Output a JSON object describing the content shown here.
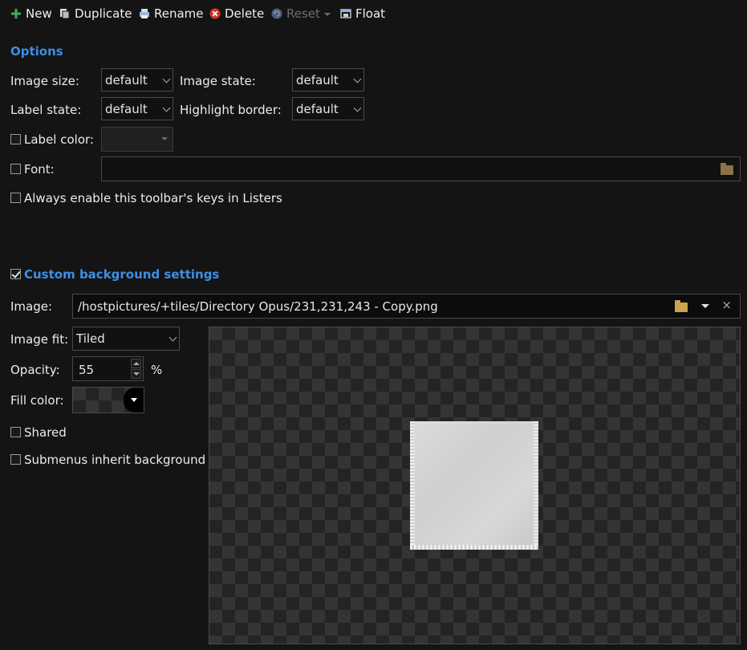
{
  "toolbar": {
    "new_label": "New",
    "duplicate_label": "Duplicate",
    "rename_label": "Rename",
    "delete_label": "Delete",
    "reset_label": "Reset",
    "float_label": "Float"
  },
  "options": {
    "title": "Options",
    "image_size_label": "Image size:",
    "image_size_value": "default",
    "image_state_label": "Image state:",
    "image_state_value": "default",
    "label_state_label": "Label state:",
    "label_state_value": "default",
    "highlight_border_label": "Highlight border:",
    "highlight_border_value": "default",
    "label_color_label": "Label color:",
    "label_color_checked": false,
    "font_label": "Font:",
    "font_checked": false,
    "font_value": "",
    "always_enable_label": "Always enable this toolbar's keys in Listers",
    "always_enable_checked": false
  },
  "background": {
    "title": "Custom background settings",
    "enabled": true,
    "image_label": "Image:",
    "image_path": "/hostpictures/+tiles/Directory Opus/231,231,243 - Copy.png",
    "image_fit_label": "Image fit:",
    "image_fit_value": "Tiled",
    "opacity_label": "Opacity:",
    "opacity_value": "55",
    "opacity_unit": "%",
    "fill_color_label": "Fill color:",
    "shared_label": "Shared",
    "shared_checked": false,
    "submenus_label": "Submenus inherit background",
    "submenus_checked": false
  },
  "colors": {
    "accent": "#3d8ee8",
    "background": "#141414",
    "new_icon": "#3fae5a",
    "delete_icon": "#d9342b"
  },
  "icons": {
    "new": "plus-icon",
    "duplicate": "copy-icon",
    "rename": "printer-icon",
    "delete": "delete-icon",
    "reset": "undo-icon",
    "float": "window-icon"
  }
}
